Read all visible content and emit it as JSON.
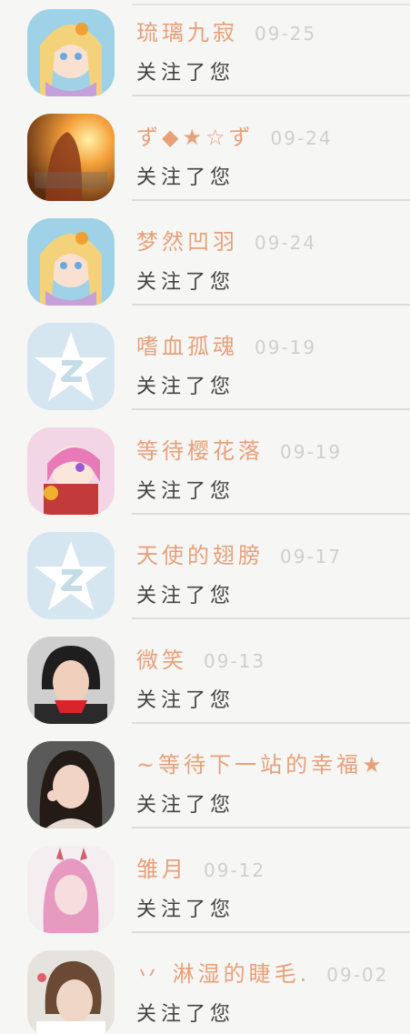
{
  "items": [
    {
      "name": "琉璃九寂",
      "date": "09-25",
      "message": "关注了您",
      "avatar": "anime-girl-avatar"
    },
    {
      "name": "ず◆★☆ず",
      "date": "09-24",
      "message": "关注了您",
      "avatar": "sunset-photo-avatar"
    },
    {
      "name": "梦然凹羽",
      "date": "09-24",
      "message": "关注了您",
      "avatar": "anime-girl-avatar"
    },
    {
      "name": "嗜血孤魂",
      "date": "09-19",
      "message": "关注了您",
      "avatar": "default-qzone-avatar"
    },
    {
      "name": "等待樱花落",
      "date": "09-19",
      "message": "关注了您",
      "avatar": "anime-character-avatar"
    },
    {
      "name": "天使的翅膀",
      "date": "09-17",
      "message": "关注了您",
      "avatar": "default-qzone-avatar"
    },
    {
      "name": "微笑",
      "date": "09-13",
      "message": "关注了您",
      "avatar": "woman-photo-avatar"
    },
    {
      "name": "~等待下一站的幸福★",
      "date": "",
      "message": "关注了您",
      "avatar": "woman-photo-avatar"
    },
    {
      "name": "雏月",
      "date": "09-12",
      "message": "关注了您",
      "avatar": "pink-hair-avatar"
    },
    {
      "name": "丷 淋湿的睫毛.",
      "date": "09-02",
      "message": "关注了您",
      "avatar": "woman-photo-avatar"
    }
  ]
}
